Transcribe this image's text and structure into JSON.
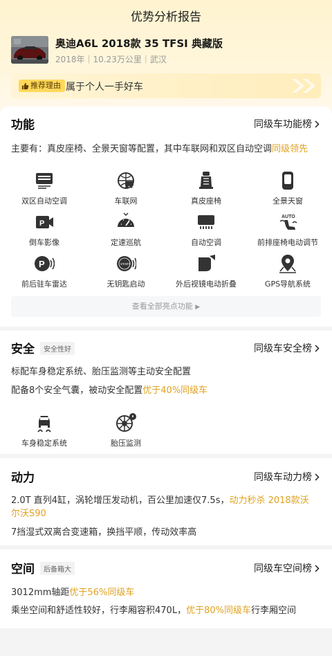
{
  "header": {
    "title": "优势分析报告"
  },
  "car": {
    "name": "奥迪A6L 2018款 35 TFSI 典藏版",
    "meta": "2018年｜10.23万公里｜武汉"
  },
  "reason": {
    "tag": "推荐理由",
    "text": "属于个人一手好车"
  },
  "function_section": {
    "title": "功能",
    "link": "同级车功能榜",
    "desc_prefix": "主要有：真皮座椅、全景天窗等配置，其中车联网和双区自动空调",
    "desc_highlight": "同级领先",
    "features": [
      {
        "label": "双区自动空调",
        "icon": "dual-zone-ac-icon"
      },
      {
        "label": "车联网",
        "icon": "connected-car-icon"
      },
      {
        "label": "真皮座椅",
        "icon": "leather-seat-icon"
      },
      {
        "label": "全景天窗",
        "icon": "panoramic-sunroof-icon"
      },
      {
        "label": "倒车影像",
        "icon": "reverse-camera-icon"
      },
      {
        "label": "定速巡航",
        "icon": "cruise-control-icon"
      },
      {
        "label": "自动空调",
        "icon": "auto-ac-icon"
      },
      {
        "label": "前排座椅电动调节",
        "icon": "power-seat-icon"
      },
      {
        "label": "前后驻车雷达",
        "icon": "parking-radar-icon"
      },
      {
        "label": "无钥匙启动",
        "icon": "keyless-start-icon"
      },
      {
        "label": "外后视镜电动折叠",
        "icon": "mirror-fold-icon"
      },
      {
        "label": "GPS导航系统",
        "icon": "gps-nav-icon"
      }
    ],
    "see_all": "查看全部亮点功能"
  },
  "safety_section": {
    "title": "安全",
    "tag": "安全性好",
    "link": "同级车安全榜",
    "line1": "标配车身稳定系统、胎压监测等主动安全配置",
    "line2_prefix": "配备8个安全气囊，被动安全配置",
    "line2_highlight": "优于40%同级车",
    "features": [
      {
        "label": "车身稳定系统",
        "icon": "stability-control-icon"
      },
      {
        "label": "胎压监测",
        "icon": "tire-pressure-icon"
      }
    ]
  },
  "power_section": {
    "title": "动力",
    "link": "同级车动力榜",
    "line1_prefix": "2.0T 直列4缸，涡轮增压发动机，百公里加速仅7.5s，",
    "line1_highlight": "动力秒杀 2018款沃",
    "line2_highlight": "尔沃S90",
    "line3": "7挡湿式双离合变速箱，换挡平顺，传动效率高"
  },
  "space_section": {
    "title": "空间",
    "tag": "后备箱大",
    "link": "同级车空间榜",
    "line1_prefix": "3012mm轴距",
    "line1_highlight": "优于56%同级车",
    "line2_prefix": "乘坐空间和舒适性较好，行李厢容积470L，",
    "line2_highlight": "优于80%同级车",
    "line2_suffix": "行李厢空间"
  },
  "colors": {
    "accent": "#e0a21f",
    "tag_yellow": "#ffd85a"
  }
}
